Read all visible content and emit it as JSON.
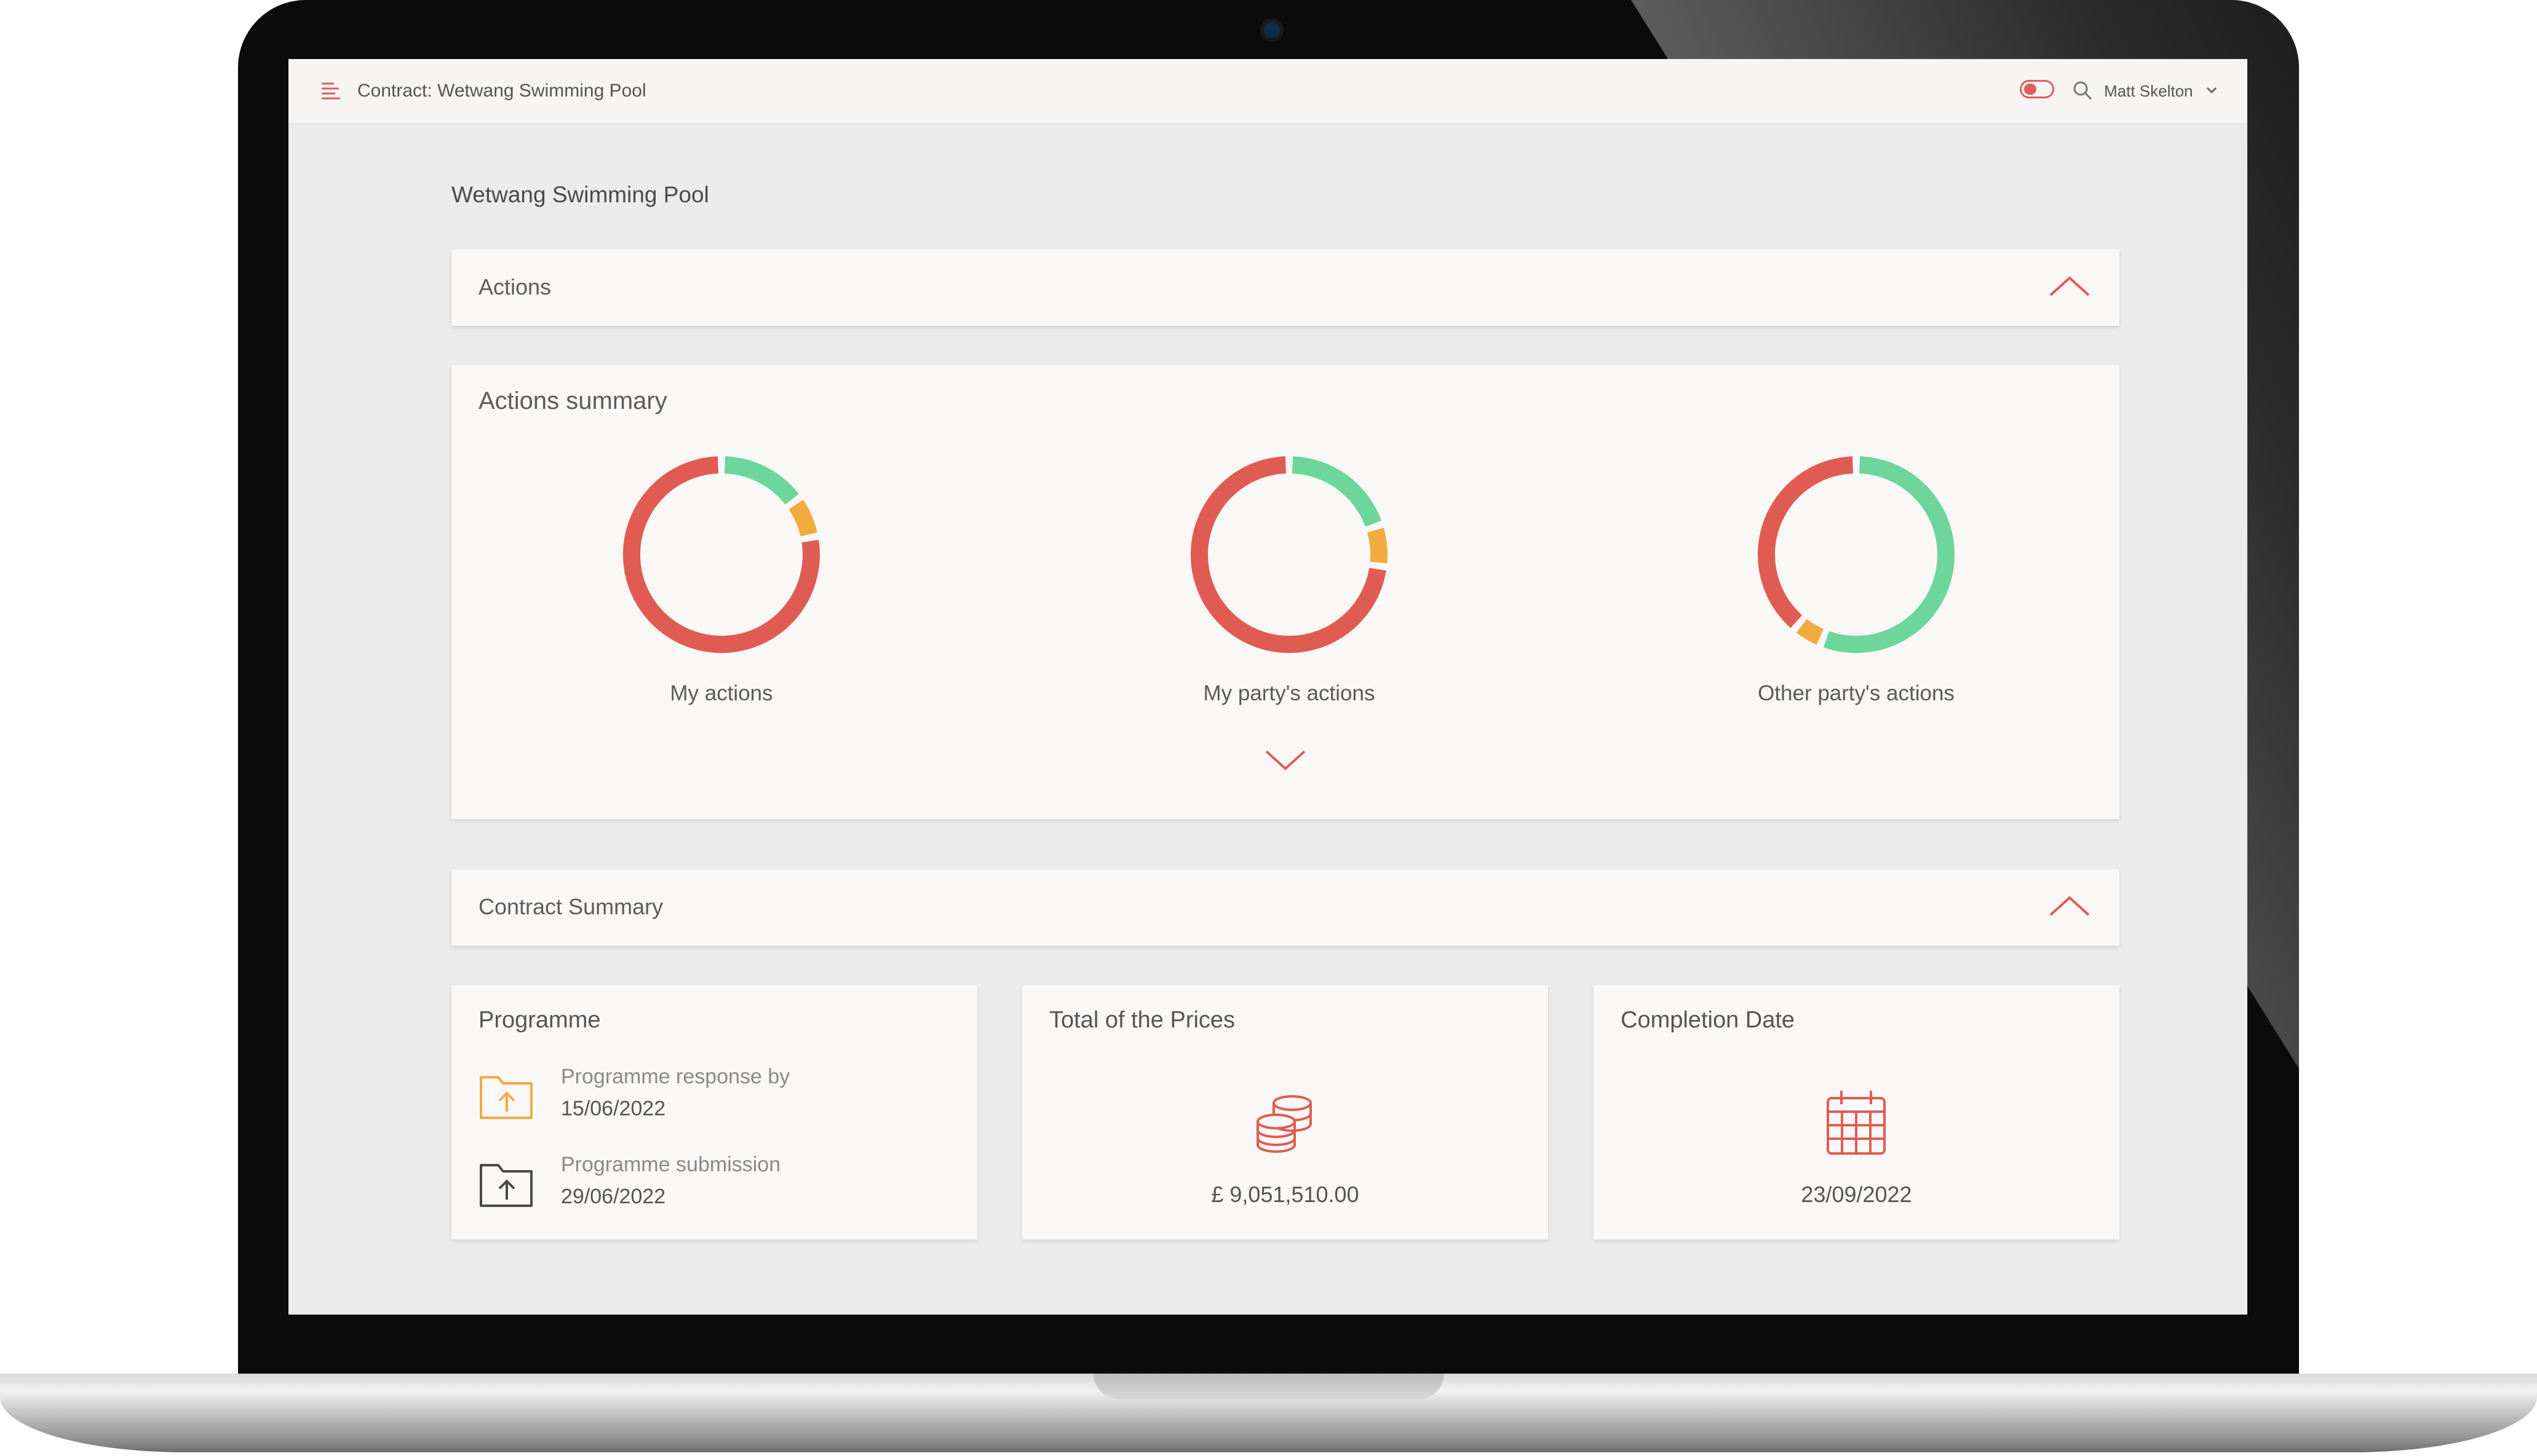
{
  "header": {
    "contract_title": "Contract: Wetwang Swimming Pool",
    "user_name": "Matt Skelton"
  },
  "page": {
    "title": "Wetwang Swimming Pool"
  },
  "actions_panel": {
    "label": "Actions"
  },
  "actions_summary": {
    "title": "Actions summary",
    "colors": {
      "overdue": "#e05c52",
      "due_soon": "#f2ab3f",
      "on_time": "#6dd69a"
    }
  },
  "chart_data": {
    "type": "pie",
    "charts": [
      {
        "label": "My actions",
        "segments": [
          {
            "color": "#6dd69a",
            "fraction": 0.15
          },
          {
            "color": "#f2ab3f",
            "fraction": 0.07
          },
          {
            "color": "#e05c52",
            "fraction": 0.78
          }
        ]
      },
      {
        "label": "My party's actions",
        "segments": [
          {
            "color": "#6dd69a",
            "fraction": 0.2
          },
          {
            "color": "#f2ab3f",
            "fraction": 0.07
          },
          {
            "color": "#e05c52",
            "fraction": 0.73
          }
        ]
      },
      {
        "label": "Other party's actions",
        "segments": [
          {
            "color": "#6dd69a",
            "fraction": 0.56
          },
          {
            "color": "#f2ab3f",
            "fraction": 0.05
          },
          {
            "color": "#e05c52",
            "fraction": 0.39
          }
        ]
      }
    ]
  },
  "contract_summary": {
    "label": "Contract Summary"
  },
  "programme_card": {
    "title": "Programme",
    "items": [
      {
        "label": "Programme response by",
        "date": "15/06/2022",
        "icon": "folder-upload-icon",
        "color": "#f2ab3f"
      },
      {
        "label": "Programme submission",
        "date": "29/06/2022",
        "icon": "folder-upload-icon",
        "color": "#4a4a4a"
      }
    ]
  },
  "prices_card": {
    "title": "Total of the Prices",
    "value": "£ 9,051,510.00",
    "icon": "coins-icon",
    "color": "#e05c52"
  },
  "completion_card": {
    "title": "Completion Date",
    "value": "23/09/2022",
    "icon": "calendar-icon",
    "color": "#e05c52"
  }
}
